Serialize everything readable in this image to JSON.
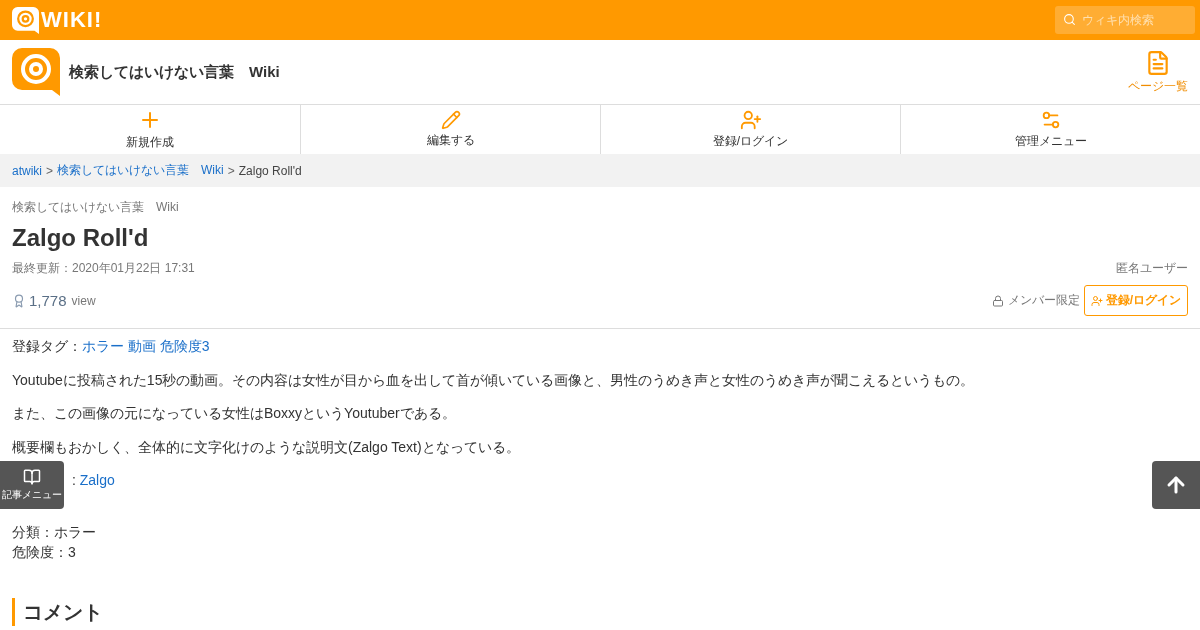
{
  "topbar": {
    "logo_text": "WIKI!",
    "search": {
      "placeholder": "ウィキ内検索"
    }
  },
  "header": {
    "site_title": "検索してはいけない言葉　Wiki",
    "page_list": "ページ一覧"
  },
  "nav": [
    {
      "kind": "create",
      "label": "新規作成"
    },
    {
      "kind": "edit",
      "label": "編集する"
    },
    {
      "kind": "login",
      "label": "登録/ログイン"
    },
    {
      "kind": "admin",
      "label": "管理メニュー"
    }
  ],
  "breadcrumb": [
    {
      "label": "atwiki",
      "link": true
    },
    {
      "separator": ">",
      "label": "検索してはいけない言葉　Wiki",
      "link": true
    },
    {
      "separator": ">",
      "label": "Zalgo Roll'd",
      "link": false
    }
  ],
  "page": {
    "site": "検索してはいけない言葉　Wiki",
    "title": "Zalgo Roll'd",
    "updated": "最終更新：2020年01月22日 17:31",
    "author": "匿名ユーザー",
    "views": "1,778",
    "views_unit": "view",
    "restriction": "メンバー限定",
    "login_button": "登録/ログイン"
  },
  "body": {
    "tags_label": "登録タグ：",
    "tags": [
      "ホラー",
      "動画",
      "危険度3"
    ],
    "paragraphs": [
      "Youtubeに投稿された15秒の動画。その内容は女性が目から血を出して首が傾いている画像と、男性のうめき声と女性のうめき声が聞こえるというもの。",
      "また、この画像の元になっている女性はBoxxyというYoutuberである。",
      "概要欄もおかしく、全体的に文字化けのような説明文(Zalgo Text)となっている。"
    ],
    "related_prefix": ":",
    "related_link": "Zalgo",
    "info": [
      "分類：ホラー",
      "危険度：3"
    ],
    "comment_heading": "コメント"
  },
  "float_menu": "記事メニュー"
}
